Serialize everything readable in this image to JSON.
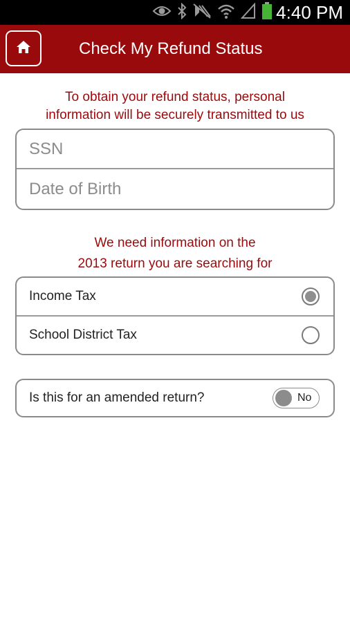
{
  "status_bar": {
    "time": "4:40 PM",
    "icons": [
      "eye-icon",
      "bluetooth-icon",
      "mute-icon",
      "wifi-icon",
      "signal-icon",
      "battery-icon"
    ],
    "battery_color": "#46b535"
  },
  "app_bar": {
    "title": "Check My Refund Status",
    "home_icon": "home-icon",
    "background_color": "#980a0b"
  },
  "intro": {
    "line1": "To obtain your refund status, personal",
    "line2": "information will be securely transmitted to us"
  },
  "identity_form": {
    "ssn_placeholder": "SSN",
    "ssn_value": "",
    "dob_placeholder": "Date of Birth",
    "dob_value": ""
  },
  "return_info": {
    "line1": "We need information on the",
    "line2": "2013 return you are searching for"
  },
  "tax_type": {
    "options": [
      {
        "label": "Income Tax",
        "selected": true
      },
      {
        "label": "School District Tax",
        "selected": false
      }
    ]
  },
  "amended": {
    "question": "Is this for an amended return?",
    "toggle_label": "No",
    "value": false
  }
}
